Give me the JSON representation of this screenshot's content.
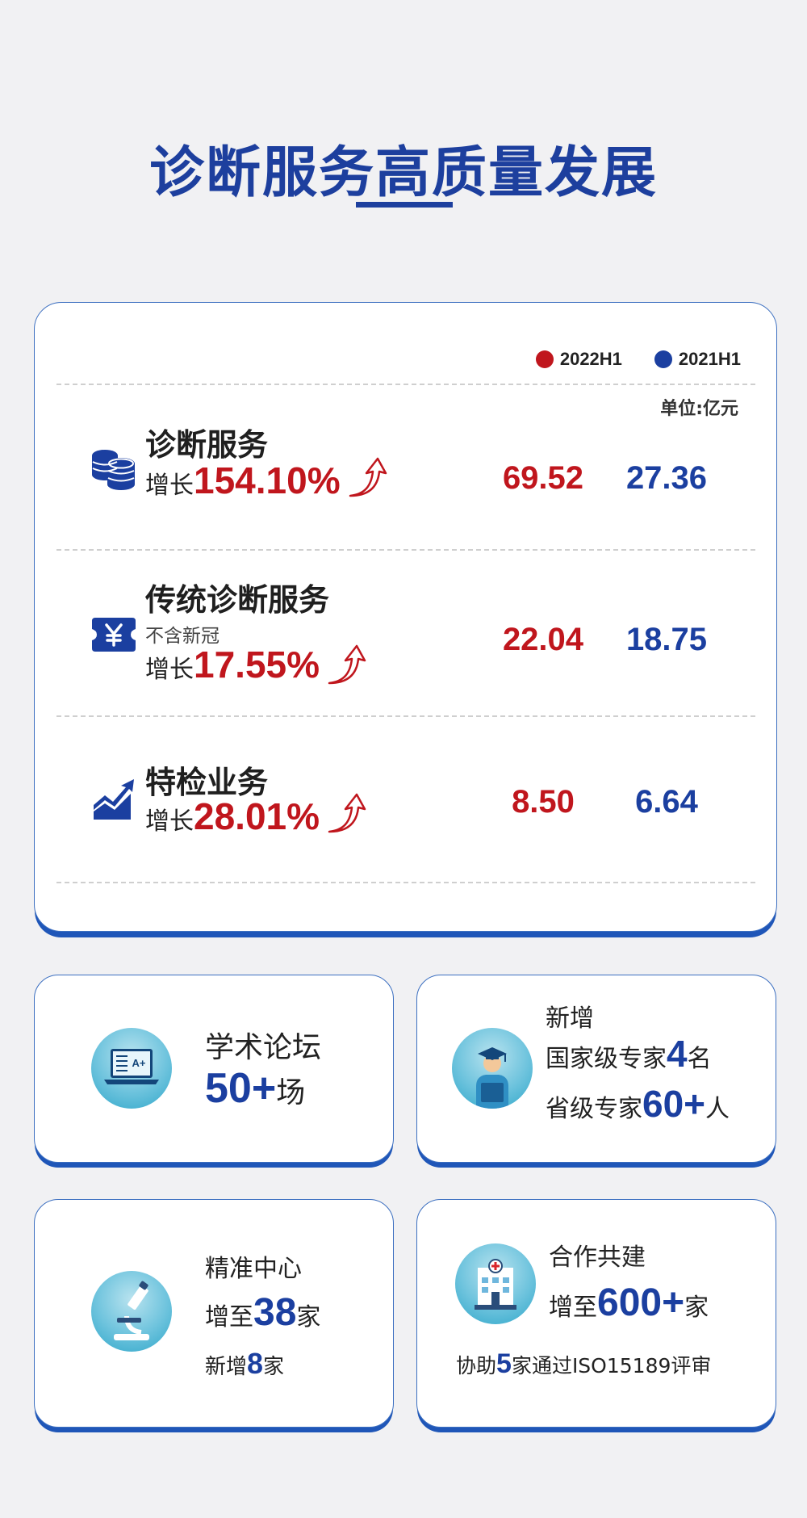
{
  "header": {
    "title": "诊断服务高质量发展"
  },
  "legend": {
    "current": "2022H1",
    "previous": "2021H1",
    "unit": "单位:亿元",
    "current_color": "#c0161d",
    "previous_color": "#1b3fa0"
  },
  "rows": [
    {
      "icon": "coins-stack-icon",
      "name": "诊断服务",
      "sub": "",
      "growth_label": "增长",
      "growth_value": "154.10%",
      "current": "69.52",
      "previous": "27.36"
    },
    {
      "icon": "yuan-ticket-icon",
      "name": "传统诊断服务",
      "sub": "不含新冠",
      "growth_label": "增长",
      "growth_value": "17.55%",
      "current": "22.04",
      "previous": "18.75"
    },
    {
      "icon": "trend-chart-icon",
      "name": "特检业务",
      "sub": "",
      "growth_label": "增长",
      "growth_value": "28.01%",
      "current": "8.50",
      "previous": "6.64"
    }
  ],
  "cards": {
    "forum": {
      "icon": "laptop-grade-icon",
      "title": "学术论坛",
      "value": "50+",
      "suffix": "场"
    },
    "experts": {
      "icon": "graduate-expert-icon",
      "prefix": "新增",
      "national_label": "国家级专家",
      "national_value": "4",
      "national_suffix": "名",
      "provincial_label": "省级专家",
      "provincial_value": "60+",
      "provincial_suffix": "人"
    },
    "precision": {
      "icon": "microscope-icon",
      "title": "精准中心",
      "line2_label": "增至",
      "line2_value": "38",
      "line2_suffix": "家",
      "line3_label": "新增",
      "line3_value": "8",
      "line3_suffix": "家"
    },
    "cooperation": {
      "icon": "hospital-icon",
      "title": "合作共建",
      "line2_label": "增至",
      "line2_value": "600+",
      "line2_suffix": "家",
      "line3_prefix": "协助",
      "line3_value": "5",
      "line3_suffix": "家通过ISO15189评审"
    }
  }
}
